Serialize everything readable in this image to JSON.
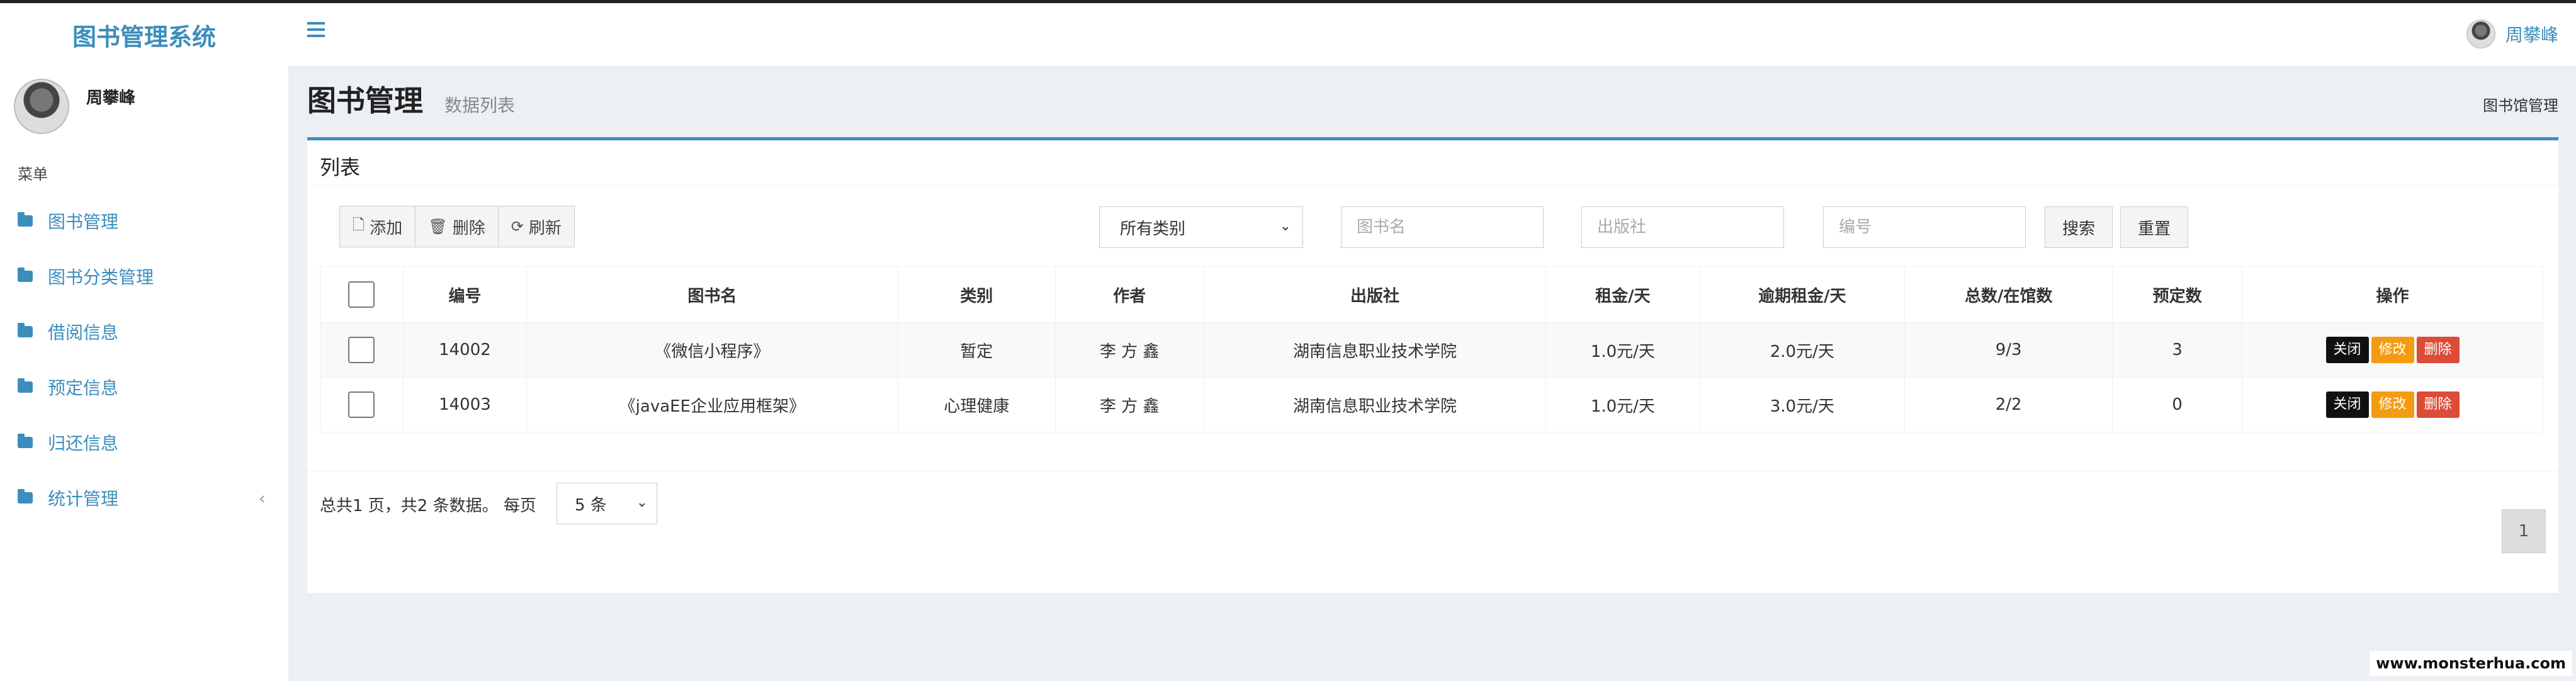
{
  "app": {
    "title": "图书管理系统",
    "user_name": "周攀峰"
  },
  "sidebar": {
    "menu_header": "菜单",
    "items": [
      {
        "label": "图书管理",
        "icon": "folder-icon"
      },
      {
        "label": "图书分类管理",
        "icon": "folder-icon"
      },
      {
        "label": "借阅信息",
        "icon": "folder-icon"
      },
      {
        "label": "预定信息",
        "icon": "folder-icon"
      },
      {
        "label": "归还信息",
        "icon": "folder-icon"
      },
      {
        "label": "统计管理",
        "icon": "folder-icon",
        "expand_glyph": "‹"
      }
    ]
  },
  "header": {
    "menu_icon": "hamburger-icon",
    "user_name": "周攀峰"
  },
  "page": {
    "title": "图书管理",
    "subtitle": "数据列表",
    "breadcrumb": "图书馆管理"
  },
  "box": {
    "title": "列表",
    "toolbar": {
      "add": "添加",
      "delete": "删除",
      "refresh": "刷新"
    },
    "filters": {
      "category_selected": "所有类别",
      "book_name_placeholder": "图书名",
      "publisher_placeholder": "出版社",
      "number_placeholder": "编号",
      "search": "搜索",
      "reset": "重置"
    },
    "table": {
      "columns": [
        "编号",
        "图书名",
        "类别",
        "作者",
        "出版社",
        "租金/天",
        "逾期租金/天",
        "总数/在馆数",
        "预定数",
        "操作"
      ],
      "rows": [
        {
          "id": "14002",
          "name": "《微信小程序》",
          "category": "暂定",
          "author": "李 方 鑫",
          "publisher": "湖南信息职业技术学院",
          "rent": "1.0元/天",
          "overdue": "2.0元/天",
          "stock": "9/3",
          "reserved": "3"
        },
        {
          "id": "14003",
          "name": "《javaEE企业应用框架》",
          "category": "心理健康",
          "author": "李 方 鑫",
          "publisher": "湖南信息职业技术学院",
          "rent": "1.0元/天",
          "overdue": "3.0元/天",
          "stock": "2/2",
          "reserved": "0"
        }
      ],
      "actions": {
        "close": "关闭",
        "edit": "修改",
        "delete": "删除"
      }
    },
    "pager": {
      "summary": "总共1 页，共2 条数据。 每页",
      "page_size": "5 条",
      "current_page": "1"
    }
  },
  "watermark": "www.monsterhua.com"
}
